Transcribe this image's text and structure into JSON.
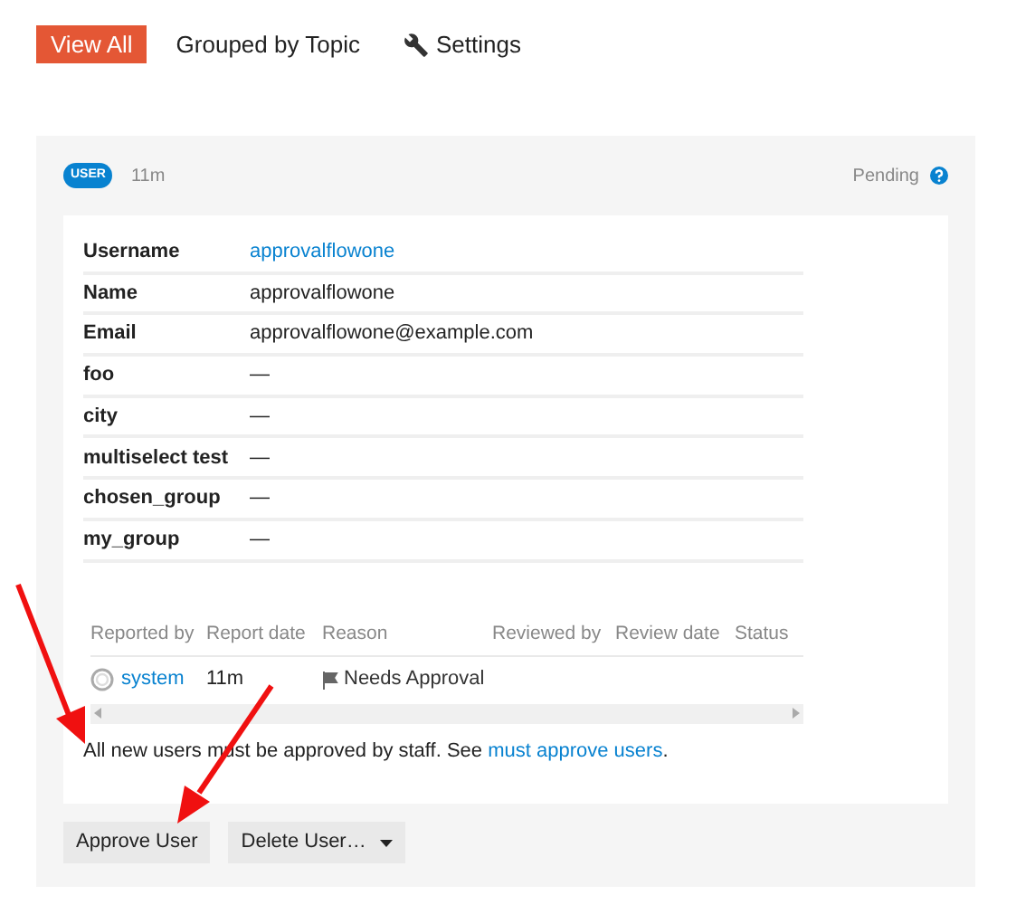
{
  "tabs": [
    {
      "label": "View All",
      "selected": true,
      "kind": "text"
    },
    {
      "label": "Grouped by Topic",
      "selected": false,
      "kind": "text"
    },
    {
      "label": "Settings",
      "selected": false,
      "kind": "settings"
    }
  ],
  "review_item": {
    "badge": "USER",
    "age": "11m",
    "status": "Pending",
    "fields": [
      {
        "label": "Username",
        "value": "approvalflowone",
        "kind": "link"
      },
      {
        "label": "Name",
        "value": "approvalflowone",
        "kind": "text"
      },
      {
        "label": "Email",
        "value": "approvalflowone@example.com",
        "kind": "text"
      },
      {
        "label": "foo",
        "value": "—",
        "kind": "text"
      },
      {
        "label": "city",
        "value": "—",
        "kind": "text"
      },
      {
        "label": "multiselect test",
        "value": "—",
        "kind": "text"
      },
      {
        "label": "chosen_group",
        "value": "—",
        "kind": "text"
      },
      {
        "label": "my_group",
        "value": "—",
        "kind": "text"
      }
    ],
    "reports": {
      "columns": [
        "Reported by",
        "Report date",
        "Reason",
        "Reviewed by",
        "Review date",
        "Status"
      ],
      "rows": [
        {
          "reported_by": "system",
          "report_date": "11m",
          "reason": "Needs Approval"
        }
      ]
    },
    "note": {
      "text": "All new users must be approved by staff. See ",
      "link": "must approve users",
      "end": "."
    },
    "actions": [
      {
        "label": "Approve User",
        "kind": "plain"
      },
      {
        "label": "Delete User…",
        "kind": "dropdown"
      }
    ]
  }
}
